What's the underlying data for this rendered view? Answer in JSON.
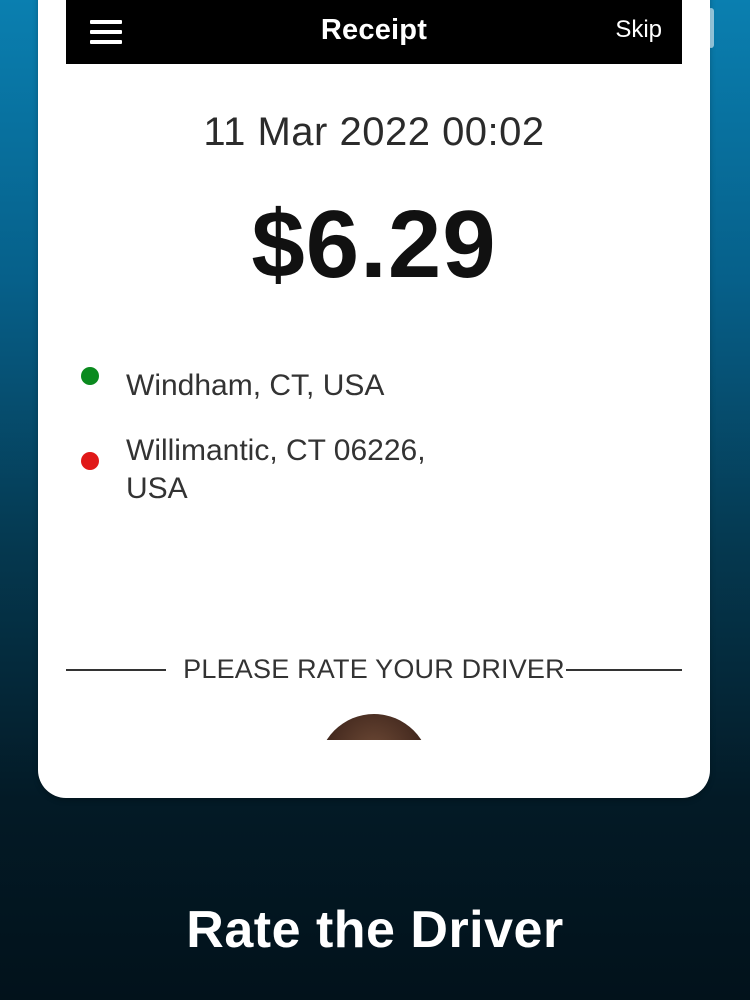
{
  "app_bar": {
    "title": "Receipt",
    "skip_label": "Skip",
    "menu_icon": "hamburger-menu-icon",
    "background": "#000000"
  },
  "receipt": {
    "date": "11 Mar 2022 00:02",
    "fare": "$6.29"
  },
  "route": {
    "pickup": {
      "address": "Windham, CT, USA",
      "dot_color": "#0a8a1e"
    },
    "dropoff": {
      "address": "Willimantic, CT 06226, USA",
      "dot_color": "#e01818"
    }
  },
  "rating": {
    "label": "PLEASE RATE YOUR DRIVER"
  },
  "caption": {
    "text": "Rate the Driver"
  },
  "colors": {
    "background_top": "#0a7fb0",
    "background_bottom": "#02121b",
    "caption_text": "#ffffff"
  }
}
